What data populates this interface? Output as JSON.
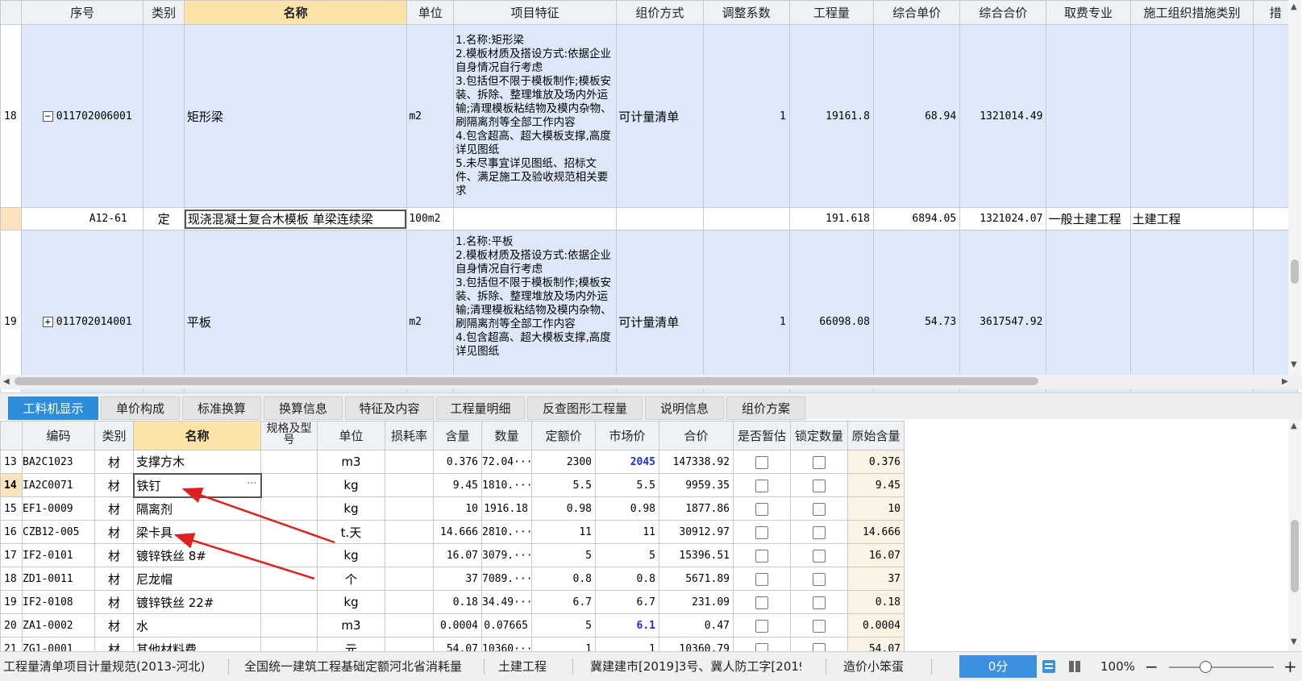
{
  "top_grid": {
    "columns": [
      "序号",
      "类别",
      "名称",
      "单位",
      "项目特征",
      "组价方式",
      "调整系数",
      "工程量",
      "综合单价",
      "综合合价",
      "取费专业",
      "施工组织措施类别",
      "措"
    ],
    "rows": [
      {
        "seq": "18",
        "tree_toggle": "−",
        "code": "011702006001",
        "type": "",
        "name": "矩形梁",
        "unit": "m2",
        "features": "1.名称:矩形梁\n2.模板材质及搭设方式:依据企业自身情况自行考虑\n3.包括但不限于模板制作;模板安装、拆除、整理堆放及场内外运输;清理模板粘结物及模内杂物、刷隔离剂等全部工作内容\n4.包含超高、超大模板支撑,高度详见图纸\n5.未尽事宜详见图纸、招标文件、满足施工及验收规范相关要求",
        "pricing": "可计量清单",
        "coef": "1",
        "qty": "19161.8",
        "unit_price": "68.94",
        "total": "1321014.49",
        "fee_type": "",
        "measure_type": ""
      },
      {
        "seq": "",
        "tree_toggle": "",
        "code": "A12-61",
        "type": "定",
        "name": "现浇混凝土复合木模板 单梁连续梁",
        "unit": "100m2",
        "features": "",
        "pricing": "",
        "coef": "",
        "qty": "191.618",
        "unit_price": "6894.05",
        "total": "1321024.07",
        "fee_type": "一般土建工程",
        "measure_type": "土建工程"
      },
      {
        "seq": "19",
        "tree_toggle": "+",
        "code": "011702014001",
        "type": "",
        "name": "平板",
        "unit": "m2",
        "features": "1.名称:平板\n2.模板材质及搭设方式:依据企业自身情况自行考虑\n3.包括但不限于模板制作;模板安装、拆除、整理堆放及场内外运输;清理模板粘结物及模内杂物、刷隔离剂等全部工作内容\n4.包含超高、超大模板支撑,高度详见图纸",
        "pricing": "可计量清单",
        "coef": "1",
        "qty": "66098.08",
        "unit_price": "54.73",
        "total": "3617547.92",
        "fee_type": "",
        "measure_type": ""
      }
    ]
  },
  "tabs": [
    "工料机显示",
    "单价构成",
    "标准换算",
    "换算信息",
    "特征及内容",
    "工程量明细",
    "反查图形工程量",
    "说明信息",
    "组价方案"
  ],
  "bottom_grid": {
    "columns": [
      "编码",
      "类别",
      "名称",
      "规格及型号",
      "单位",
      "损耗率",
      "含量",
      "数量",
      "定额价",
      "市场价",
      "合价",
      "是否暂估",
      "锁定数量",
      "原始含量"
    ],
    "rows": [
      {
        "n": "13",
        "code": "BA2C1023",
        "type": "材",
        "name": "支撑方木",
        "spec": "",
        "unit": "m3",
        "loss": "",
        "content": "0.376",
        "qty": "72.04···",
        "quota": "2300",
        "market": "2045",
        "total": "147338.92",
        "orig": "0.376"
      },
      {
        "n": "14",
        "code": "IA2C0071",
        "type": "材",
        "name": "铁钉",
        "spec": "",
        "unit": "kg",
        "loss": "",
        "content": "9.45",
        "qty": "1810.···",
        "quota": "5.5",
        "market": "5.5",
        "total": "9959.35",
        "orig": "9.45"
      },
      {
        "n": "15",
        "code": "EF1-0009",
        "type": "材",
        "name": "隔离剂",
        "spec": "",
        "unit": "kg",
        "loss": "",
        "content": "10",
        "qty": "1916.18",
        "quota": "0.98",
        "market": "0.98",
        "total": "1877.86",
        "orig": "10"
      },
      {
        "n": "16",
        "code": "CZB12-005",
        "type": "材",
        "name": "梁卡具",
        "spec": "",
        "unit": "t.天",
        "loss": "",
        "content": "14.666",
        "qty": "2810.···",
        "quota": "11",
        "market": "11",
        "total": "30912.97",
        "orig": "14.666"
      },
      {
        "n": "17",
        "code": "IF2-0101",
        "type": "材",
        "name": "镀锌铁丝 8#",
        "spec": "",
        "unit": "kg",
        "loss": "",
        "content": "16.07",
        "qty": "3079.···",
        "quota": "5",
        "market": "5",
        "total": "15396.51",
        "orig": "16.07"
      },
      {
        "n": "18",
        "code": "ZD1-0011",
        "type": "材",
        "name": "尼龙帽",
        "spec": "",
        "unit": "个",
        "loss": "",
        "content": "37",
        "qty": "7089.···",
        "quota": "0.8",
        "market": "0.8",
        "total": "5671.89",
        "orig": "37"
      },
      {
        "n": "19",
        "code": "IF2-0108",
        "type": "材",
        "name": "镀锌铁丝 22#",
        "spec": "",
        "unit": "kg",
        "loss": "",
        "content": "0.18",
        "qty": "34.49···",
        "quota": "6.7",
        "market": "6.7",
        "total": "231.09",
        "orig": "0.18"
      },
      {
        "n": "20",
        "code": "ZA1-0002",
        "type": "材",
        "name": "水",
        "spec": "",
        "unit": "m3",
        "loss": "",
        "content": "0.0004",
        "qty": "0.07665",
        "quota": "5",
        "market": "6.1",
        "total": "0.47",
        "orig": "0.0004"
      },
      {
        "n": "21",
        "code": "ZG1-0001",
        "type": "材",
        "name": "其他材料费",
        "spec": "",
        "unit": "元",
        "loss": "",
        "content": "54.07",
        "qty": "10360···",
        "quota": "1",
        "market": "1",
        "total": "10360.79",
        "orig": "54.07"
      }
    ]
  },
  "statusbar": {
    "items": [
      "工程量清单项目计量规范(2013-河北)",
      "全国统一建筑工程基础定额河北省消耗量",
      "土建工程",
      "冀建建市[2019]3号、冀人防工字[2019]",
      "造价小笨蛋"
    ],
    "score": "0分",
    "zoom": "100%",
    "zoom_minus": "−",
    "zoom_plus": "+"
  },
  "colors": {
    "tab_active": "#2e8ddb",
    "row_highlight": "#dde9fb",
    "header_highlight": "#fde3a7",
    "market_price_changed": "#1a2fd6",
    "annotation_arrow": "#e02020"
  }
}
